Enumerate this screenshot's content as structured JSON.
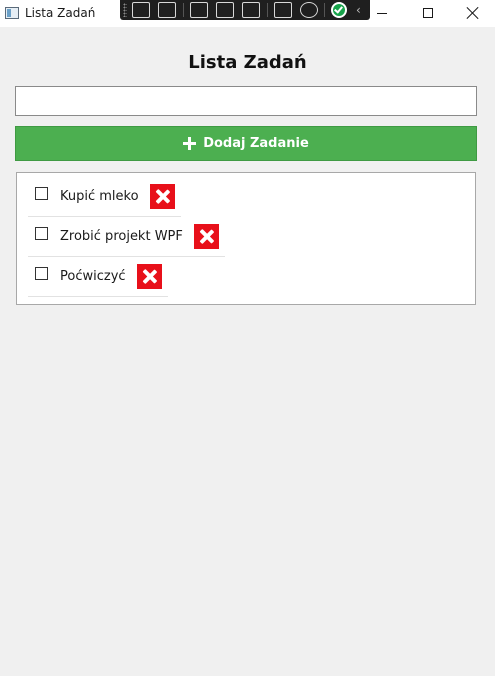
{
  "window": {
    "title": "Lista Zadań"
  },
  "debug_toolbar": {
    "icons": [
      "select-element-icon",
      "video-icon",
      "pointer-icon",
      "layout-adorner-icon",
      "track-focus-icon",
      "binding-failures-icon",
      "accessibility-icon",
      "status-ok-icon",
      "collapse-icon"
    ]
  },
  "main": {
    "heading": "Lista Zadań",
    "input": {
      "value": "",
      "placeholder": ""
    },
    "add_button_label": "Dodaj Zadanie",
    "tasks": [
      {
        "label": "Kupić mleko",
        "checked": false
      },
      {
        "label": "Zrobić projekt WPF",
        "checked": false
      },
      {
        "label": "Poćwiczyć",
        "checked": false
      }
    ]
  },
  "colors": {
    "add_button": "#4caf50",
    "delete_button": "#e8101a",
    "background": "#f0f0f0"
  }
}
